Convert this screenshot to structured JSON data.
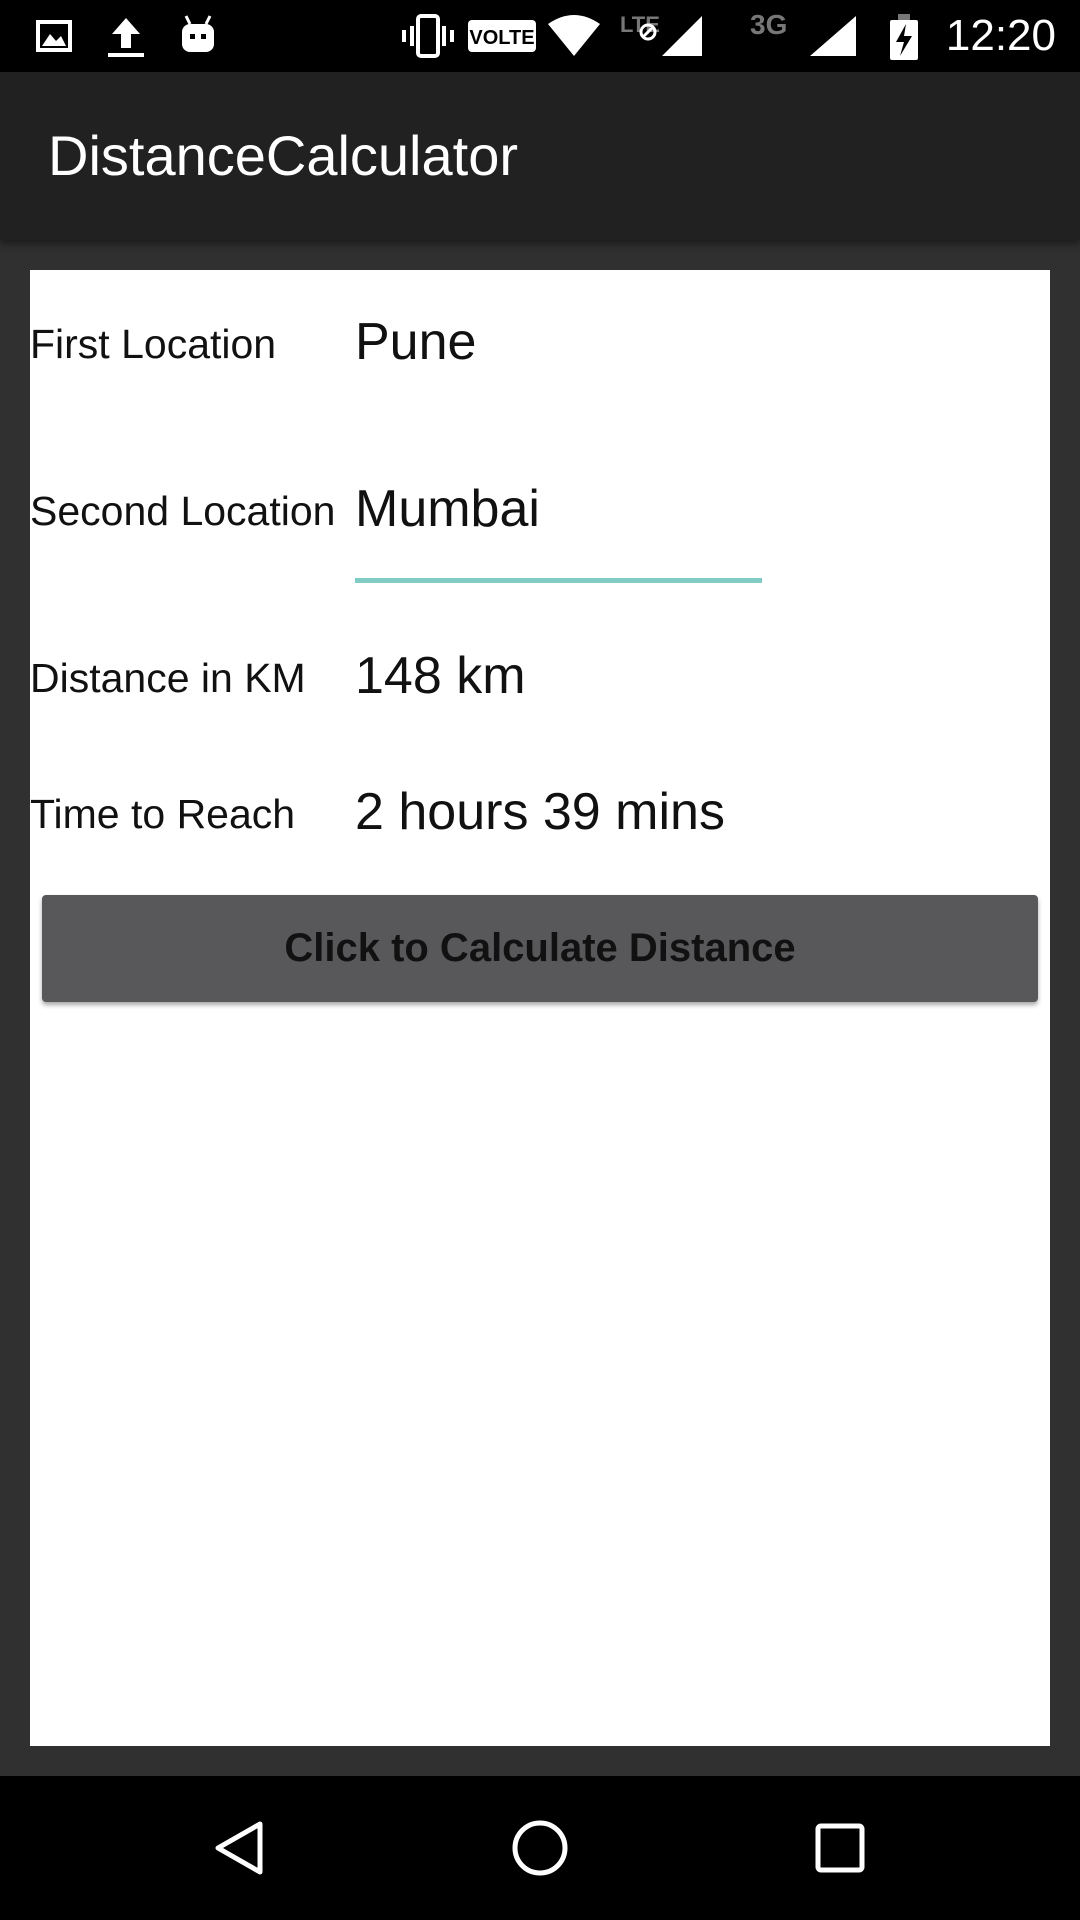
{
  "status_bar": {
    "time": "12:20",
    "icons": [
      "image-icon",
      "upload-icon",
      "android-icon",
      "vibrate-icon",
      "volte-badge",
      "wifi-icon",
      "lte-signal-icon",
      "3g-signal-icon",
      "battery-charging-icon"
    ],
    "volte_label": "VOLTE",
    "lte_label": "LTE",
    "threeg_label": "3G"
  },
  "app_bar": {
    "title": "DistanceCalculator"
  },
  "form": {
    "first_location": {
      "label": "First Location",
      "value": "Pune"
    },
    "second_location": {
      "label": "Second Location",
      "value": "Mumbai"
    },
    "distance": {
      "label": "Distance in KM",
      "value": "148 km"
    },
    "time_to_reach": {
      "label": "Time to Reach",
      "value": "2 hours 39 mins"
    }
  },
  "button": {
    "label": "Click to Calculate Distance"
  },
  "nav_bar": {
    "icons": [
      "back-icon",
      "home-icon",
      "recents-icon"
    ]
  },
  "colors": {
    "status_bar": "#000000",
    "app_bar": "#212121",
    "background": "#303030",
    "card": "#ffffff",
    "field_accent": "#80cbc4",
    "button": "#58585a"
  }
}
